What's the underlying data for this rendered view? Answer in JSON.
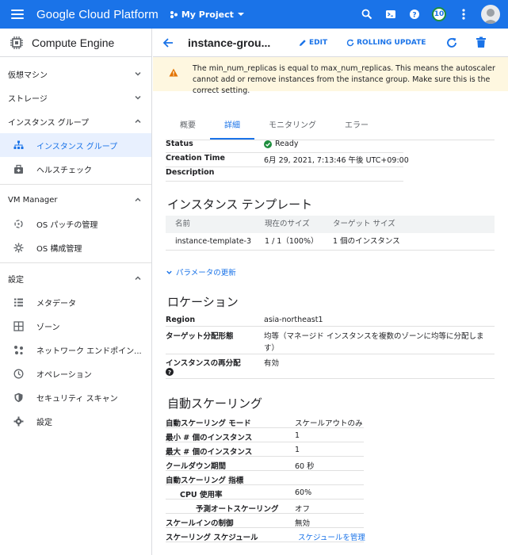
{
  "topbar": {
    "brand": "Google Cloud Platform",
    "project": "My Project",
    "badge": "10",
    "colors": {
      "bar": "#1a73e8"
    }
  },
  "sidebar": {
    "title": "Compute Engine",
    "sections": [
      {
        "label": "仮想マシン",
        "state": "collapsed"
      },
      {
        "label": "ストレージ",
        "state": "collapsed"
      },
      {
        "label": "インスタンス グループ",
        "state": "expanded"
      }
    ],
    "group_items": [
      {
        "label": "インスタンス グループ",
        "icon": "instance-group-icon",
        "active": true
      },
      {
        "label": "ヘルスチェック",
        "icon": "health-check-icon"
      }
    ],
    "vm_manager": {
      "label": "VM Manager"
    },
    "vm_items": [
      {
        "label": "OS パッチの管理",
        "icon": "os-patch-icon"
      },
      {
        "label": "OS 構成管理",
        "icon": "os-config-icon"
      }
    ],
    "settings": {
      "label": "設定"
    },
    "settings_items": [
      {
        "label": "メタデータ",
        "icon": "metadata-icon"
      },
      {
        "label": "ゾーン",
        "icon": "zones-icon"
      },
      {
        "label": "ネットワーク エンドポイン...",
        "icon": "network-endpoint-icon"
      },
      {
        "label": "オペレーション",
        "icon": "operations-icon"
      },
      {
        "label": "セキュリティ スキャン",
        "icon": "security-scan-icon"
      },
      {
        "label": "設定",
        "icon": "settings-gear-icon"
      }
    ]
  },
  "header": {
    "title": "instance-grou...",
    "edit": "EDIT",
    "rolling_update": "ROLLING UPDATE"
  },
  "alert": {
    "text": "The min_num_replicas is equal to max_num_replicas. This means the autoscaler cannot add or remove instances from the instance group. Make sure this is the correct setting."
  },
  "tabs": [
    "概要",
    "詳細",
    "モニタリング",
    "エラー"
  ],
  "details": {
    "status_label": "Status",
    "status_value": "Ready",
    "creation_label": "Creation Time",
    "creation_value": "6月 29, 2021, 7:13:46 午後 UTC+09:00",
    "description_label": "Description"
  },
  "template": {
    "heading": "インスタンス テンプレート",
    "columns": [
      "名前",
      "現在のサイズ",
      "ターゲット サイズ"
    ],
    "row": [
      "instance-template-3",
      "1 / 1（100%）",
      "1 個のインスタンス"
    ],
    "params_link": "パラメータの更新"
  },
  "location": {
    "heading": "ロケーション",
    "region_label": "Region",
    "region_value": "asia-northeast1",
    "target_label": "ターゲット分配形態",
    "target_value_1": "均等（マネージド インスタンスを複数のゾーンに均等に分配しま",
    "target_value_2": "す）",
    "redistribute_label": "インスタンスの再分配",
    "redistribute_value": "有効"
  },
  "autoscaling": {
    "heading": "自動スケーリング",
    "mode_label": "自動スケーリング モード",
    "mode_value": "スケールアウトのみ",
    "min_label": "最小 # 個のインスタンス",
    "min_value": "1",
    "max_label": "最大 # 個のインスタンス",
    "max_value": "1",
    "cooldown_label": "クールダウン期間",
    "cooldown_value": "60 秒",
    "metrics_label": "自動スケーリング 指標",
    "cpu_label": "CPU 使用率",
    "cpu_value": "60%",
    "predictive_label": "予測オートスケーリング",
    "predictive_value": "オフ",
    "scalein_label": "スケールインの制御",
    "scalein_value": "無効",
    "schedule_label": "スケーリング スケジュール",
    "schedule_link": "スケジュールを管理"
  }
}
